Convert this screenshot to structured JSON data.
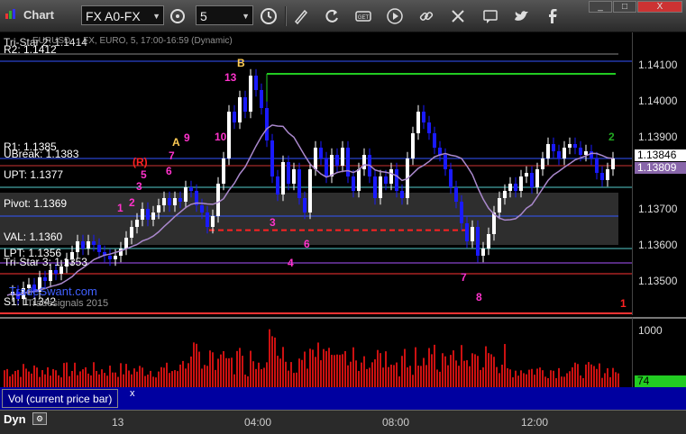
{
  "window": {
    "title": "Chart",
    "minimize_label": "_",
    "maximize_label": "□",
    "close_label": "X"
  },
  "toolbar": {
    "symbol_value": "FX A0-FX",
    "interval_value": "5",
    "tools": [
      "symbol-settings-icon",
      "clock-icon",
      "draw-icon",
      "refresh-icon",
      "get-data-icon",
      "play-icon",
      "link-icon",
      "comment-icon",
      "twitter-icon",
      "facebook-icon"
    ]
  },
  "chart_header": {
    "text": "Tri-Star 2: 1.1414",
    "subtitle": "EURUSD ... FX, EURO, 5, 17:00-16:59 (Dynamic)"
  },
  "levels": {
    "r2": "R2: 1.1412",
    "r1": "R1: 1.1385",
    "ubreak": "UBreak: 1.1383",
    "upt": "UPT: 1.1377",
    "pivot": "Pivot: 1.1369",
    "val": "VAL: 1.1360",
    "lpt": "LPT: 1.1356",
    "tristar3": "Tri-Star 3: 1.1353",
    "s1": "S1: 1.1342",
    "watermark": "TradeSwant.com",
    "copyright": "Tradesignals 2015"
  },
  "price_axis": {
    "ticks": [
      "1.14100",
      "1.14000",
      "1.13900",
      "1.13700",
      "1.13600",
      "1.13500"
    ],
    "last_price": "1.13846",
    "ma_price": "1.13809",
    "tick_values": [
      1.141,
      1.14,
      1.139,
      1.137,
      1.136,
      1.135
    ]
  },
  "volume": {
    "label": "Vol (current price bar)",
    "close": "x",
    "tick": "1000",
    "last": "74"
  },
  "time_axis": {
    "labels": [
      "13",
      "04:00",
      "08:00",
      "12:00"
    ],
    "dyn_label": "Dyn"
  },
  "annotations": {
    "seq_labels": [
      "13",
      "9",
      "7",
      "6",
      "5",
      "(R)",
      "3",
      "2",
      "1",
      "10",
      "3",
      "6",
      "4",
      "7",
      "8",
      "2",
      "1"
    ],
    "letters": [
      "A",
      "B"
    ]
  },
  "colors": {
    "up": "#ffffff",
    "down": "#1a1aff",
    "volume": "#cc1111",
    "ma": "#aa88cc",
    "pivot_zone": "#333333"
  }
}
